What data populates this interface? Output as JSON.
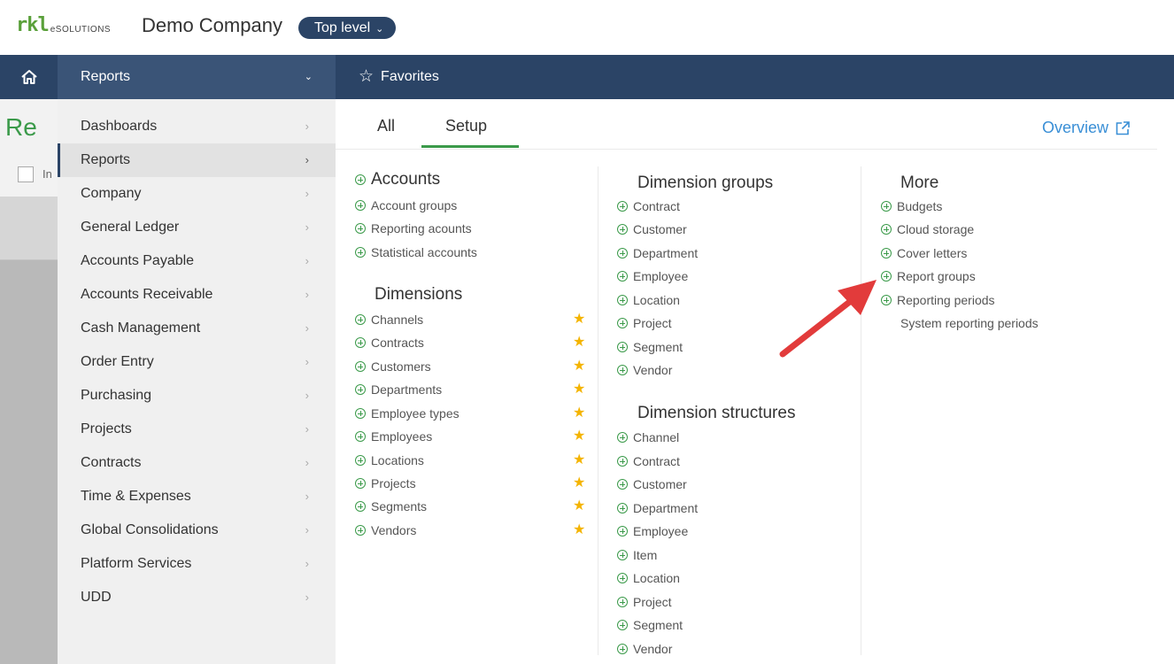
{
  "header": {
    "logo_mark": "rkl",
    "logo_sub": "eSOLUTIONS",
    "company": "Demo Company",
    "entity_selector": "Top level"
  },
  "nav": {
    "reports_label": "Reports",
    "favorites_label": "Favorites"
  },
  "background": {
    "page_title_fragment": "Re",
    "checkbox_fragment": "In"
  },
  "sidebar": {
    "items": [
      {
        "label": "Dashboards"
      },
      {
        "label": "Reports"
      },
      {
        "label": "Company"
      },
      {
        "label": "General Ledger"
      },
      {
        "label": "Accounts Payable"
      },
      {
        "label": "Accounts Receivable"
      },
      {
        "label": "Cash Management"
      },
      {
        "label": "Order Entry"
      },
      {
        "label": "Purchasing"
      },
      {
        "label": "Projects"
      },
      {
        "label": "Contracts"
      },
      {
        "label": "Time & Expenses"
      },
      {
        "label": "Global Consolidations"
      },
      {
        "label": "Platform Services"
      },
      {
        "label": "UDD"
      }
    ],
    "active_index": 1
  },
  "panel": {
    "tabs": [
      {
        "label": "All"
      },
      {
        "label": "Setup"
      }
    ],
    "active_tab": "Setup",
    "overview_label": "Overview",
    "col1": {
      "accounts_heading": "Accounts",
      "accounts_items": [
        "Account groups",
        "Reporting acounts",
        "Statistical accounts"
      ],
      "dimensions_heading": "Dimensions",
      "dimensions_items": [
        "Channels",
        "Contracts",
        "Customers",
        "Departments",
        "Employee types",
        "Employees",
        "Locations",
        "Projects",
        "Segments",
        "Vendors"
      ]
    },
    "col2": {
      "groups_heading": "Dimension groups",
      "groups_items": [
        "Contract",
        "Customer",
        "Department",
        "Employee",
        "Location",
        "Project",
        "Segment",
        "Vendor"
      ],
      "structures_heading": "Dimension structures",
      "structures_items": [
        "Channel",
        "Contract",
        "Customer",
        "Department",
        "Employee",
        "Item",
        "Location",
        "Project",
        "Segment",
        "Vendor"
      ]
    },
    "col3": {
      "more_heading": "More",
      "more_items": [
        "Budgets",
        "Cloud storage",
        "Cover letters",
        "Report groups",
        "Reporting periods"
      ],
      "plain_item": "System reporting periods"
    }
  },
  "colors": {
    "navy": "#2b4466",
    "green": "#3b9a4a",
    "link_blue": "#3a8fd6",
    "star": "#f4b400",
    "arrow_red": "#e23b3b"
  }
}
